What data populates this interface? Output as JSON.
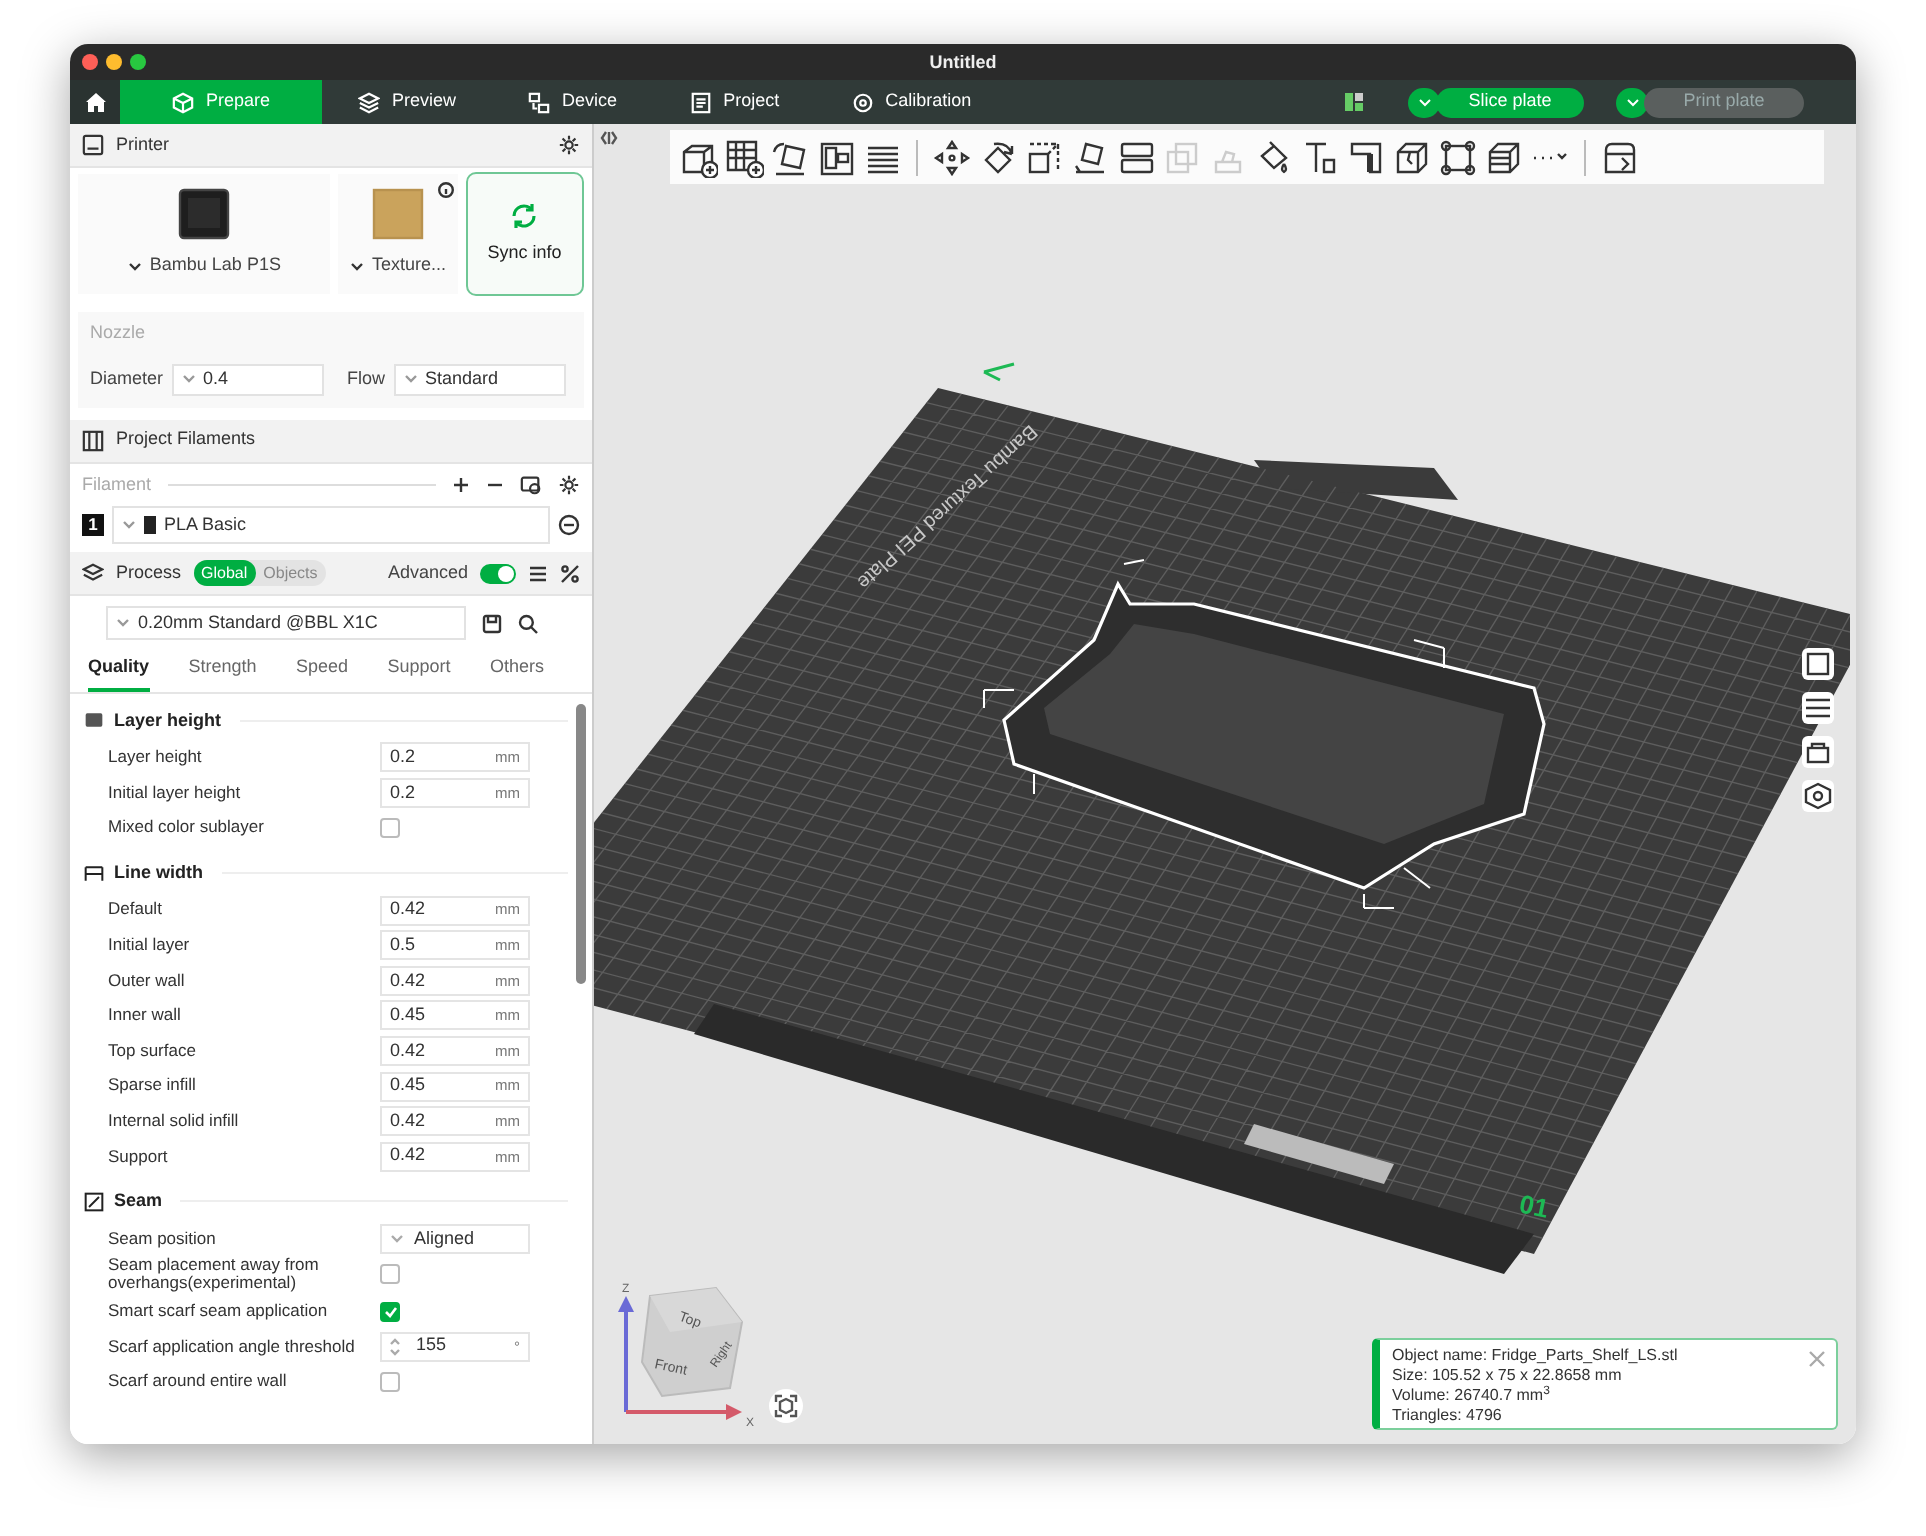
{
  "window": {
    "title": "Untitled"
  },
  "tabs": [
    {
      "label": "Prepare",
      "selected": true
    },
    {
      "label": "Preview",
      "selected": false
    },
    {
      "label": "Device",
      "selected": false
    },
    {
      "label": "Project",
      "selected": false
    },
    {
      "label": "Calibration",
      "selected": false
    }
  ],
  "actions": [
    {
      "label": "Slice plate",
      "disabled": false
    },
    {
      "label": "Print plate",
      "disabled": true
    }
  ],
  "printer": {
    "title": "Printer",
    "printer_name": "Bambu Lab P1S",
    "plate": "Texture...",
    "sync": "Sync info",
    "nozzle_label": "Nozzle",
    "diameter_label": "Diameter",
    "diameter": "0.4",
    "flow_label": "Flow",
    "flow": "Standard"
  },
  "filaments": {
    "title": "Project Filaments",
    "label": "Filament",
    "items": [
      {
        "index": "1",
        "name": "PLA Basic"
      }
    ]
  },
  "process": {
    "title": "Process",
    "scopes": [
      {
        "label": "Global",
        "selected": true
      },
      {
        "label": "Objects",
        "selected": false
      }
    ],
    "advanced_label": "Advanced",
    "advanced": true,
    "preset": "0.20mm Standard @BBL X1C",
    "tabs": [
      {
        "label": "Quality",
        "selected": true
      },
      {
        "label": "Strength",
        "selected": false
      },
      {
        "label": "Speed",
        "selected": false
      },
      {
        "label": "Support",
        "selected": false
      },
      {
        "label": "Others",
        "selected": false
      }
    ]
  },
  "groups": [
    {
      "title": "Layer height",
      "rows": [
        {
          "kind": "number",
          "label": "Layer height",
          "value": "0.2",
          "unit": "mm"
        },
        {
          "kind": "number",
          "label": "Initial layer height",
          "value": "0.2",
          "unit": "mm"
        },
        {
          "kind": "checkbox",
          "label": "Mixed color sublayer",
          "checked": false
        }
      ]
    },
    {
      "title": "Line width",
      "rows": [
        {
          "kind": "number",
          "label": "Default",
          "value": "0.42",
          "unit": "mm"
        },
        {
          "kind": "number",
          "label": "Initial layer",
          "value": "0.5",
          "unit": "mm"
        },
        {
          "kind": "number",
          "label": "Outer wall",
          "value": "0.42",
          "unit": "mm"
        },
        {
          "kind": "number",
          "label": "Inner wall",
          "value": "0.45",
          "unit": "mm"
        },
        {
          "kind": "number",
          "label": "Top surface",
          "value": "0.42",
          "unit": "mm"
        },
        {
          "kind": "number",
          "label": "Sparse infill",
          "value": "0.45",
          "unit": "mm"
        },
        {
          "kind": "number",
          "label": "Internal solid infill",
          "value": "0.42",
          "unit": "mm"
        },
        {
          "kind": "number",
          "label": "Support",
          "value": "0.42",
          "unit": "mm"
        }
      ]
    },
    {
      "title": "Seam",
      "rows": [
        {
          "kind": "select",
          "label": "Seam position",
          "value": "Aligned"
        },
        {
          "kind": "checkbox",
          "label": "Seam placement away from overhangs(experimental)",
          "checked": false
        },
        {
          "kind": "checkbox",
          "label": "Smart scarf seam application",
          "checked": true
        },
        {
          "kind": "spin",
          "label": "Scarf application angle threshold",
          "value": "155",
          "unit": "°"
        },
        {
          "kind": "checkbox",
          "label": "Scarf around entire wall",
          "checked": false
        }
      ]
    }
  ],
  "plate": {
    "label": "Bambu Textured PEI Plate",
    "number": "01"
  },
  "view_cube": {
    "faces": [
      "Top",
      "Front",
      "Right"
    ],
    "axes": [
      "Z",
      "X"
    ]
  },
  "object_info": {
    "lines": [
      "Object name: Fridge_Parts_Shelf_LS.stl",
      "Size: 105.52 x 75 x 22.8658 mm",
      "Volume: 26740.7 mm$^{3}$",
      "Triangles: 4796"
    ]
  }
}
